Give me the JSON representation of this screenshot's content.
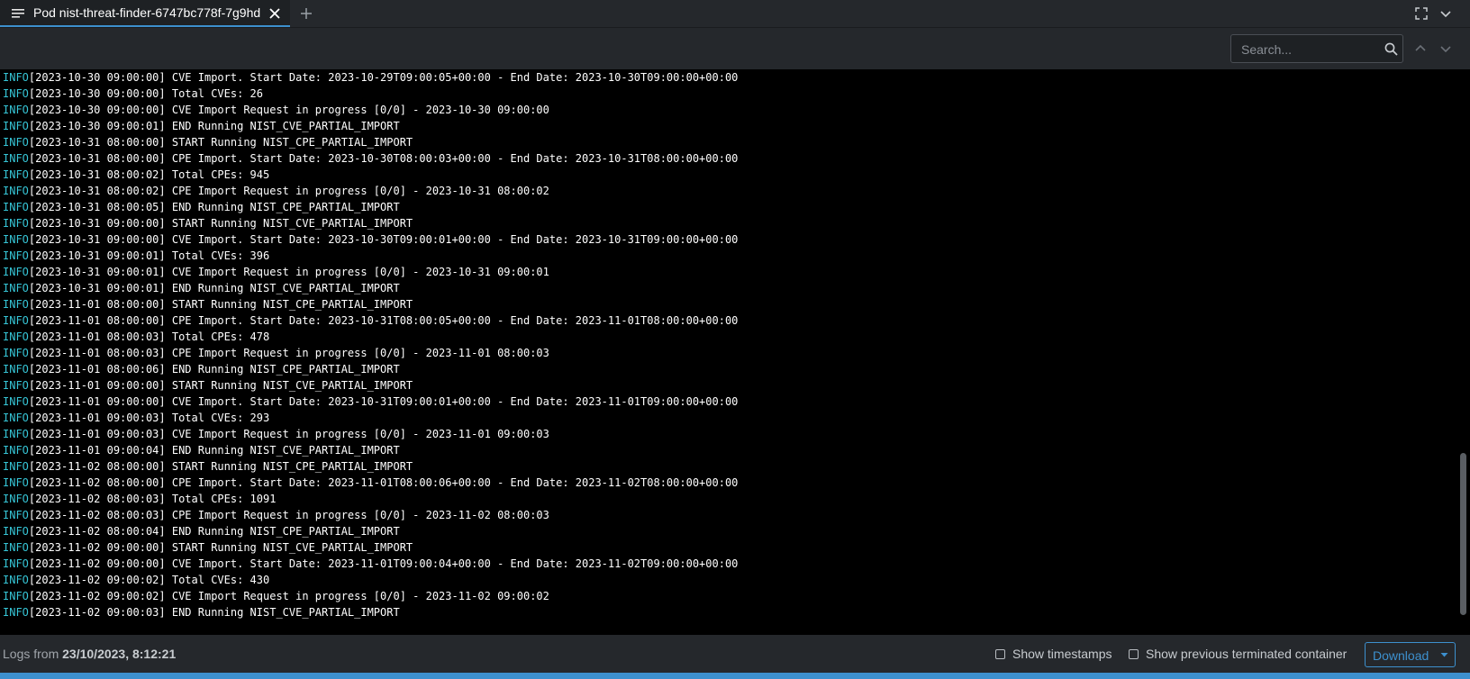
{
  "tab": {
    "icon": "menu-lines-icon",
    "title": "Pod nist-threat-finder-6747bc778f-7g9hd",
    "close_icon": "close-icon",
    "add_icon": "plus-icon"
  },
  "window_controls": {
    "fullscreen_icon": "fullscreen-icon",
    "collapse_icon": "chevron-down-icon"
  },
  "search": {
    "placeholder": "Search...",
    "value": "",
    "icon": "search-icon",
    "prev_icon": "chevron-up-icon",
    "next_icon": "chevron-down-icon"
  },
  "logs": [
    {
      "level": "INFO",
      "text": "[2023-10-30 09:00:00] CVE Import. Start Date: 2023-10-29T09:00:05+00:00 - End Date: 2023-10-30T09:00:00+00:00"
    },
    {
      "level": "INFO",
      "text": "[2023-10-30 09:00:00] Total CVEs: 26"
    },
    {
      "level": "INFO",
      "text": "[2023-10-30 09:00:00] CVE Import Request in progress [0/0] - 2023-10-30 09:00:00"
    },
    {
      "level": "INFO",
      "text": "[2023-10-30 09:00:01] END Running NIST_CVE_PARTIAL_IMPORT"
    },
    {
      "level": "INFO",
      "text": "[2023-10-31 08:00:00] START Running NIST_CPE_PARTIAL_IMPORT"
    },
    {
      "level": "INFO",
      "text": "[2023-10-31 08:00:00] CPE Import. Start Date: 2023-10-30T08:00:03+00:00 - End Date: 2023-10-31T08:00:00+00:00"
    },
    {
      "level": "INFO",
      "text": "[2023-10-31 08:00:02] Total CPEs: 945"
    },
    {
      "level": "INFO",
      "text": "[2023-10-31 08:00:02] CPE Import Request in progress [0/0] - 2023-10-31 08:00:02"
    },
    {
      "level": "INFO",
      "text": "[2023-10-31 08:00:05] END Running NIST_CPE_PARTIAL_IMPORT"
    },
    {
      "level": "INFO",
      "text": "[2023-10-31 09:00:00] START Running NIST_CVE_PARTIAL_IMPORT"
    },
    {
      "level": "INFO",
      "text": "[2023-10-31 09:00:00] CVE Import. Start Date: 2023-10-30T09:00:01+00:00 - End Date: 2023-10-31T09:00:00+00:00"
    },
    {
      "level": "INFO",
      "text": "[2023-10-31 09:00:01] Total CVEs: 396"
    },
    {
      "level": "INFO",
      "text": "[2023-10-31 09:00:01] CVE Import Request in progress [0/0] - 2023-10-31 09:00:01"
    },
    {
      "level": "INFO",
      "text": "[2023-10-31 09:00:01] END Running NIST_CVE_PARTIAL_IMPORT"
    },
    {
      "level": "INFO",
      "text": "[2023-11-01 08:00:00] START Running NIST_CPE_PARTIAL_IMPORT"
    },
    {
      "level": "INFO",
      "text": "[2023-11-01 08:00:00] CPE Import. Start Date: 2023-10-31T08:00:05+00:00 - End Date: 2023-11-01T08:00:00+00:00"
    },
    {
      "level": "INFO",
      "text": "[2023-11-01 08:00:03] Total CPEs: 478"
    },
    {
      "level": "INFO",
      "text": "[2023-11-01 08:00:03] CPE Import Request in progress [0/0] - 2023-11-01 08:00:03"
    },
    {
      "level": "INFO",
      "text": "[2023-11-01 08:00:06] END Running NIST_CPE_PARTIAL_IMPORT"
    },
    {
      "level": "INFO",
      "text": "[2023-11-01 09:00:00] START Running NIST_CVE_PARTIAL_IMPORT"
    },
    {
      "level": "INFO",
      "text": "[2023-11-01 09:00:00] CVE Import. Start Date: 2023-10-31T09:00:01+00:00 - End Date: 2023-11-01T09:00:00+00:00"
    },
    {
      "level": "INFO",
      "text": "[2023-11-01 09:00:03] Total CVEs: 293"
    },
    {
      "level": "INFO",
      "text": "[2023-11-01 09:00:03] CVE Import Request in progress [0/0] - 2023-11-01 09:00:03"
    },
    {
      "level": "INFO",
      "text": "[2023-11-01 09:00:04] END Running NIST_CVE_PARTIAL_IMPORT"
    },
    {
      "level": "INFO",
      "text": "[2023-11-02 08:00:00] START Running NIST_CPE_PARTIAL_IMPORT"
    },
    {
      "level": "INFO",
      "text": "[2023-11-02 08:00:00] CPE Import. Start Date: 2023-11-01T08:00:06+00:00 - End Date: 2023-11-02T08:00:00+00:00"
    },
    {
      "level": "INFO",
      "text": "[2023-11-02 08:00:03] Total CPEs: 1091"
    },
    {
      "level": "INFO",
      "text": "[2023-11-02 08:00:03] CPE Import Request in progress [0/0] - 2023-11-02 08:00:03"
    },
    {
      "level": "INFO",
      "text": "[2023-11-02 08:00:04] END Running NIST_CPE_PARTIAL_IMPORT"
    },
    {
      "level": "INFO",
      "text": "[2023-11-02 09:00:00] START Running NIST_CVE_PARTIAL_IMPORT"
    },
    {
      "level": "INFO",
      "text": "[2023-11-02 09:00:00] CVE Import. Start Date: 2023-11-01T09:00:04+00:00 - End Date: 2023-11-02T09:00:00+00:00"
    },
    {
      "level": "INFO",
      "text": "[2023-11-02 09:00:02] Total CVEs: 430"
    },
    {
      "level": "INFO",
      "text": "[2023-11-02 09:00:02] CVE Import Request in progress [0/0] - 2023-11-02 09:00:02"
    },
    {
      "level": "INFO",
      "text": "[2023-11-02 09:00:03] END Running NIST_CVE_PARTIAL_IMPORT"
    }
  ],
  "footer": {
    "logs_from_prefix": "Logs from",
    "logs_from_value": "23/10/2023, 8:12:21",
    "show_timestamps_label": "Show timestamps",
    "show_timestamps_checked": false,
    "show_previous_label": "Show previous terminated container",
    "show_previous_checked": false,
    "download_label": "Download",
    "download_icon": "caret-down-icon"
  },
  "colors": {
    "accent": "#3d90ce",
    "log_level": "#36c5d6",
    "log_background": "#000000",
    "panel_background": "#25282c"
  }
}
